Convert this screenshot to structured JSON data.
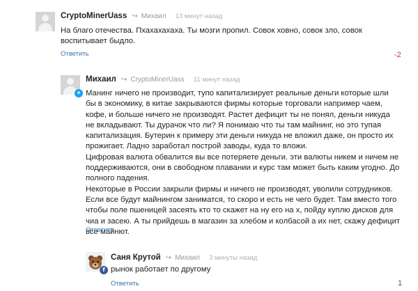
{
  "comments": [
    {
      "author": "CryptoMinerUass",
      "reply_to": "Михаил",
      "time": "13 минут назад",
      "paragraphs": [
        "На благо отечества. Пхахахахаха. Ты мозги пропил. Совок ховно, совок зло, совок воспитывает быдло."
      ],
      "reply_label": "Ответить",
      "score": "-2",
      "score_color": "#d32f2f",
      "avatar": "default-user-avatar"
    },
    {
      "author": "Михаил",
      "reply_to": "CryptoMinerUass",
      "time": "11 минут назад",
      "paragraphs": [
        "Манинг ничего не производит, тупо капитализирует реальные деньги которые шли бы в экономику, в китае закрываются фирмы которые торговали например чаем, кофе, и больше ничего не производят. Растет дефицит ты не понял, деньги никуда не вкладывают. Ты дурачок что ли? Я понимаю что ты там майнинг, но это тупая капитализация. Бутерин к примеру эти деньги никуда не вложил даже, он просто их прожигает. Ладно заработал построй заводы, куда то вложи.",
        "Цифровая валюта обвалится вы все потеряете деньги. эти валюты никем и ничем не поддерживаются, они в свободном плавании и курс там может быть каким угодно. До полного падения.",
        "Некоторые в России закрыли фирмы и ничего не производят, уволили сотрудников. Если все будут майнингом заниматся, то скоро и есть не чего будет. Там вместо того чтобы поле пшеницей засеять кто то скажет на ну его на х, пойду куплю дисков для чиа и засею.  А ты прийдешь в магазин за хлебом и колбасой а их нет, скажу дефицит все майнют."
      ],
      "reply_label": "Ответить",
      "avatar": "default-user-avatar",
      "badge": "twitter-icon",
      "badge_color": "#1da1f2"
    },
    {
      "author": "Саня Крутой",
      "reply_to": "Михаил",
      "time": "3 минуты назад",
      "paragraphs": [
        "рынок работает по другому"
      ],
      "reply_label": "Ответить",
      "score": "1",
      "score_color": "#2e7d32",
      "avatar": "bear-avatar",
      "badge": "facebook-icon",
      "badge_color": "#3b5998"
    }
  ]
}
